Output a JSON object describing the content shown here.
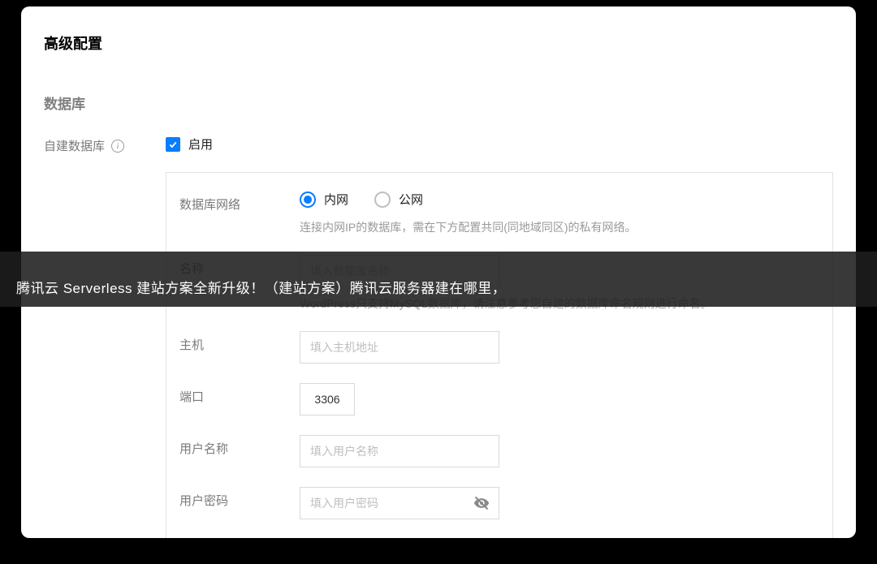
{
  "page": {
    "title": "高级配置",
    "section_db": "数据库"
  },
  "self_db": {
    "label": "自建数据库",
    "enable_label": "启用",
    "checked": true
  },
  "db_network": {
    "label": "数据库网络",
    "options": {
      "intranet": "内网",
      "public": "公网"
    },
    "selected": "intranet",
    "hint": "连接内网IP的数据库，需在下方配置共同(同地域同区)的私有网络。"
  },
  "db_name": {
    "label": "名称",
    "placeholder": "填入数据库名称",
    "hint_prefix": "WordPress",
    "hint_rest": "只支持MySQL数据库，请注意参考您自建的数据库命名规则进行命名。"
  },
  "db_host": {
    "label": "主机",
    "placeholder": "填入主机地址"
  },
  "db_port": {
    "label": "端口",
    "value": "3306"
  },
  "db_user": {
    "label": "用户名称",
    "placeholder": "填入用户名称"
  },
  "db_password": {
    "label": "用户密码",
    "placeholder": "填入用户密码"
  },
  "overlay": {
    "text": "腾讯云 Serverless 建站方案全新升级！（建站方案）腾讯云服务器建在哪里，"
  }
}
